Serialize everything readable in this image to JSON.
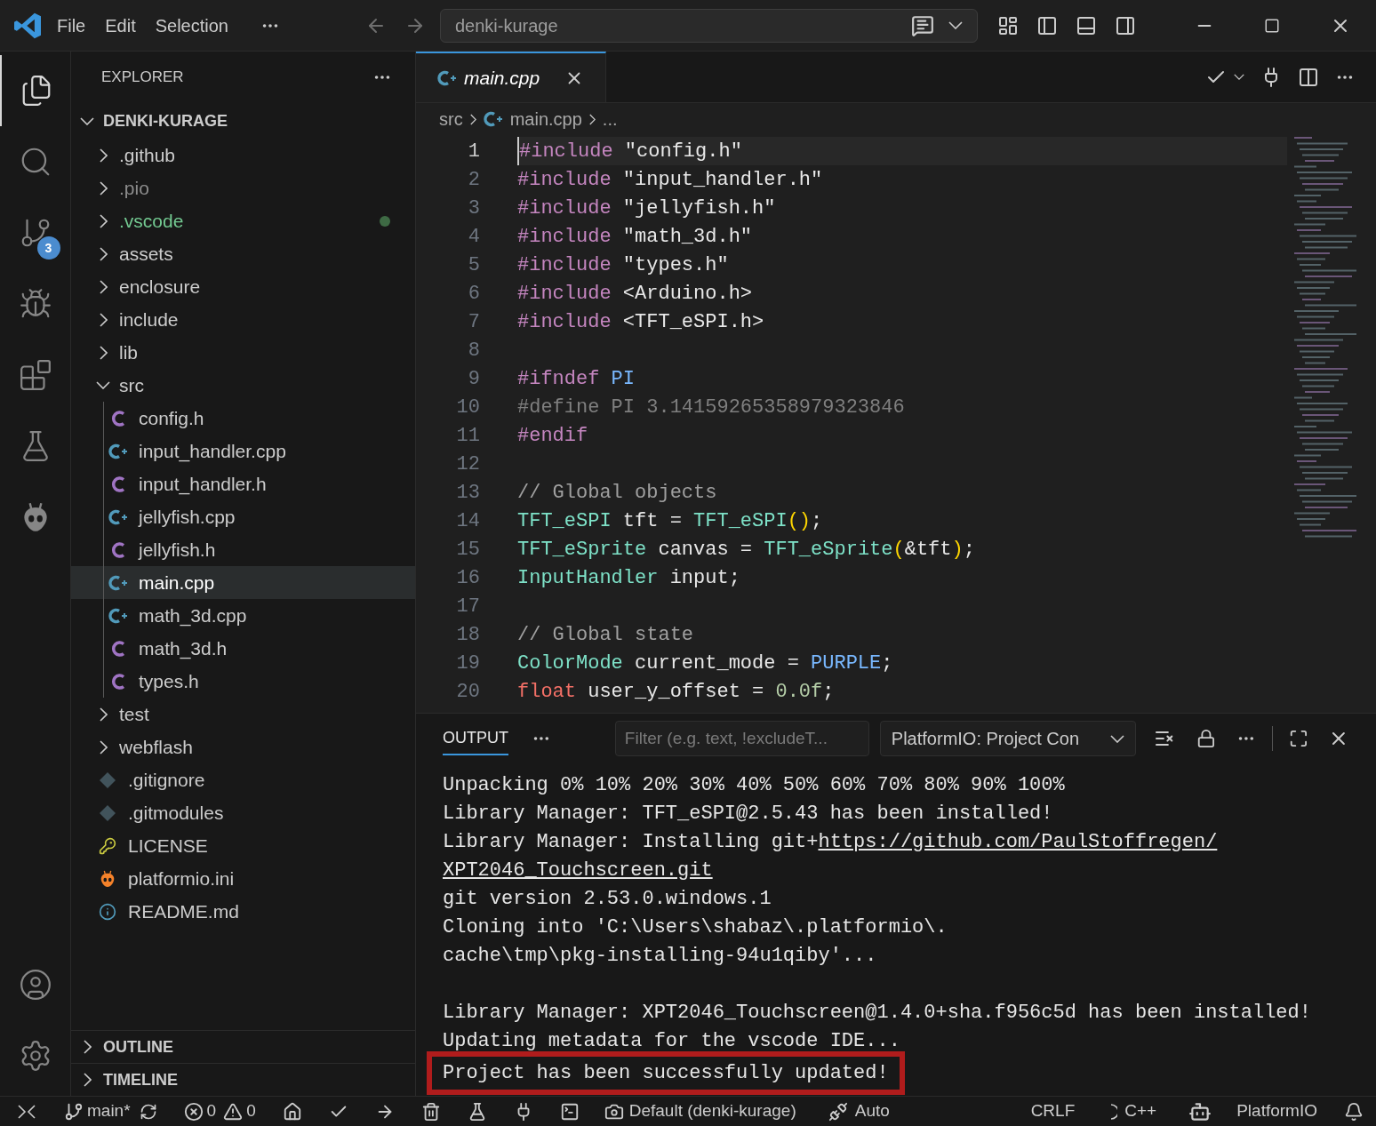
{
  "title_bar": {
    "menu": [
      "File",
      "Edit",
      "Selection"
    ],
    "command_center": "denki-kurage"
  },
  "activity_bar": {
    "items": [
      {
        "kind": "explorer",
        "selected": true
      },
      {
        "kind": "search",
        "selected": false
      },
      {
        "kind": "source-control",
        "selected": false,
        "badge": "3"
      },
      {
        "kind": "run-debug",
        "selected": false
      },
      {
        "kind": "extensions",
        "selected": false
      },
      {
        "kind": "testing",
        "selected": false
      },
      {
        "kind": "platformio",
        "selected": false
      }
    ]
  },
  "explorer": {
    "title": "EXPLORER",
    "root": {
      "label": "DENKI-KURAGE",
      "expanded": true
    },
    "items": [
      {
        "label": ".github",
        "kind": "folder",
        "ignored": false,
        "untracked": false,
        "expanded": false,
        "selected": false
      },
      {
        "label": ".pio",
        "kind": "folder",
        "ignored": true,
        "untracked": false,
        "expanded": false,
        "selected": false
      },
      {
        "label": ".vscode",
        "kind": "folder",
        "ignored": false,
        "untracked": true,
        "expanded": false,
        "selected": false
      },
      {
        "label": "assets",
        "kind": "folder",
        "ignored": false,
        "untracked": false,
        "expanded": false,
        "selected": false
      },
      {
        "label": "enclosure",
        "kind": "folder",
        "ignored": false,
        "untracked": false,
        "expanded": false,
        "selected": false
      },
      {
        "label": "include",
        "kind": "folder",
        "ignored": false,
        "untracked": false,
        "expanded": false,
        "selected": false
      },
      {
        "label": "lib",
        "kind": "folder",
        "ignored": false,
        "untracked": false,
        "expanded": false,
        "selected": false
      },
      {
        "label": "src",
        "kind": "folder",
        "ignored": false,
        "untracked": false,
        "expanded": true,
        "selected": false,
        "children": [
          {
            "label": "config.h",
            "kind": "c",
            "selected": false
          },
          {
            "label": "input_handler.cpp",
            "kind": "cpp",
            "selected": false
          },
          {
            "label": "input_handler.h",
            "kind": "c",
            "selected": false
          },
          {
            "label": "jellyfish.cpp",
            "kind": "cpp",
            "selected": false
          },
          {
            "label": "jellyfish.h",
            "kind": "c",
            "selected": false
          },
          {
            "label": "main.cpp",
            "kind": "cpp",
            "selected": true
          },
          {
            "label": "math_3d.cpp",
            "kind": "cpp",
            "selected": false
          },
          {
            "label": "math_3d.h",
            "kind": "c",
            "selected": false
          },
          {
            "label": "types.h",
            "kind": "c",
            "selected": false
          }
        ]
      },
      {
        "label": "test",
        "kind": "folder",
        "ignored": false,
        "untracked": false,
        "expanded": false,
        "selected": false
      },
      {
        "label": "webflash",
        "kind": "folder",
        "ignored": false,
        "untracked": false,
        "expanded": false,
        "selected": false
      },
      {
        "label": ".gitignore",
        "kind": "git",
        "ignored": false,
        "untracked": false,
        "selected": false
      },
      {
        "label": ".gitmodules",
        "kind": "git",
        "ignored": false,
        "untracked": false,
        "selected": false
      },
      {
        "label": "LICENSE",
        "kind": "license",
        "ignored": false,
        "untracked": false,
        "selected": false
      },
      {
        "label": "platformio.ini",
        "kind": "pio",
        "ignored": false,
        "untracked": false,
        "selected": false
      },
      {
        "label": "README.md",
        "kind": "info",
        "ignored": false,
        "untracked": false,
        "selected": false
      }
    ],
    "sections": [
      {
        "label": "OUTLINE",
        "expanded": false
      },
      {
        "label": "TIMELINE",
        "expanded": false
      }
    ]
  },
  "editor": {
    "tabs": [
      {
        "label": "main.cpp",
        "selected": true
      }
    ],
    "breadcrumbs": [
      "src",
      "main.cpp",
      "..."
    ],
    "lines": [
      {
        "number": "1",
        "selected": true,
        "tokens": [
          {
            "text": "#include",
            "kind": "directive"
          },
          {
            "text": " \"config.h\"",
            "kind": "string"
          }
        ]
      },
      {
        "number": "2",
        "selected": false,
        "tokens": [
          {
            "text": "#include",
            "kind": "directive"
          },
          {
            "text": " \"input_handler.h\"",
            "kind": "string"
          }
        ]
      },
      {
        "number": "3",
        "selected": false,
        "tokens": [
          {
            "text": "#include",
            "kind": "directive"
          },
          {
            "text": " \"jellyfish.h\"",
            "kind": "string"
          }
        ]
      },
      {
        "number": "4",
        "selected": false,
        "tokens": [
          {
            "text": "#include",
            "kind": "directive"
          },
          {
            "text": " \"math_3d.h\"",
            "kind": "string"
          }
        ]
      },
      {
        "number": "5",
        "selected": false,
        "tokens": [
          {
            "text": "#include",
            "kind": "directive"
          },
          {
            "text": " \"types.h\"",
            "kind": "string"
          }
        ]
      },
      {
        "number": "6",
        "selected": false,
        "tokens": [
          {
            "text": "#include",
            "kind": "directive"
          },
          {
            "text": " <Arduino.h>",
            "kind": "string"
          }
        ]
      },
      {
        "number": "7",
        "selected": false,
        "tokens": [
          {
            "text": "#include",
            "kind": "directive"
          },
          {
            "text": " <TFT_eSPI.h>",
            "kind": "string"
          }
        ]
      },
      {
        "number": "8",
        "selected": false
      },
      {
        "number": "9",
        "selected": false,
        "tokens": [
          {
            "text": "#ifndef",
            "kind": "directive"
          },
          {
            "text": " PI",
            "kind": "macro"
          }
        ]
      },
      {
        "number": "10",
        "selected": false,
        "tokens": [
          {
            "text": "#define PI 3.14159265358979323846",
            "kind": "inactive"
          }
        ]
      },
      {
        "number": "11",
        "selected": false,
        "tokens": [
          {
            "text": "#endif",
            "kind": "directive"
          }
        ]
      },
      {
        "number": "12",
        "selected": false
      },
      {
        "number": "13",
        "selected": false,
        "tokens": [
          {
            "text": "// Global objects",
            "kind": "comment"
          }
        ]
      },
      {
        "number": "14",
        "selected": false,
        "tokens": [
          {
            "text": "TFT_eSPI",
            "kind": "type"
          },
          {
            "text": " tft = ",
            "kind": "plain"
          },
          {
            "text": "TFT_eSPI",
            "kind": "type"
          },
          {
            "text": "()",
            "kind": "bracket"
          },
          {
            "text": ";",
            "kind": "plain"
          }
        ]
      },
      {
        "number": "15",
        "selected": false,
        "tokens": [
          {
            "text": "TFT_eSprite",
            "kind": "type"
          },
          {
            "text": " canvas = ",
            "kind": "plain"
          },
          {
            "text": "TFT_eSprite",
            "kind": "type"
          },
          {
            "text": "(",
            "kind": "bracket"
          },
          {
            "text": "&tft",
            "kind": "plain"
          },
          {
            "text": ")",
            "kind": "bracket"
          },
          {
            "text": ";",
            "kind": "plain"
          }
        ]
      },
      {
        "number": "16",
        "selected": false,
        "tokens": [
          {
            "text": "InputHandler",
            "kind": "type"
          },
          {
            "text": " input;",
            "kind": "plain"
          }
        ]
      },
      {
        "number": "17",
        "selected": false
      },
      {
        "number": "18",
        "selected": false,
        "tokens": [
          {
            "text": "// Global state",
            "kind": "comment"
          }
        ]
      },
      {
        "number": "19",
        "selected": false,
        "tokens": [
          {
            "text": "ColorMode",
            "kind": "type"
          },
          {
            "text": " current_mode = ",
            "kind": "plain"
          },
          {
            "text": "PURPLE",
            "kind": "macro"
          },
          {
            "text": ";",
            "kind": "plain"
          }
        ]
      },
      {
        "number": "20",
        "selected": false,
        "tokens": [
          {
            "text": "float",
            "kind": "keyword"
          },
          {
            "text": " user_y_offset = ",
            "kind": "plain"
          },
          {
            "text": "0.0f",
            "kind": "number"
          },
          {
            "text": ";",
            "kind": "plain"
          }
        ]
      }
    ]
  },
  "panel": {
    "tabs": [
      {
        "label": "OUTPUT",
        "selected": true
      }
    ],
    "filter_placeholder": "Filter (e.g. text, !excludeT...",
    "channel": "PlatformIO: Project Con",
    "lines": [
      {
        "kind": "text",
        "text": "Unpacking 0% 10% 20% 30% 40% 50% 60% 70% 80% 90% 100%"
      },
      {
        "kind": "text",
        "text": "Library Manager: TFT_eSPI@2.5.43 has been installed!"
      },
      {
        "kind": "text",
        "text": "Library Manager: Installing git+",
        "link": "https://github.com/PaulStoffregen/"
      },
      {
        "kind": "link",
        "text": "XPT2046_Touchscreen.git"
      },
      {
        "kind": "text",
        "text": "git version 2.53.0.windows.1"
      },
      {
        "kind": "text",
        "text": "Cloning into 'C:\\Users\\shabaz\\.platformio\\."
      },
      {
        "kind": "text",
        "text": "cache\\tmp\\pkg-installing-94u1qiby'..."
      },
      {
        "kind": "blank"
      },
      {
        "kind": "text",
        "text": "Library Manager: XPT2046_Touchscreen@1.4.0+sha.f956c5d has been installed!"
      },
      {
        "kind": "text",
        "text": "Updating metadata for the vscode IDE..."
      }
    ],
    "result_line": {
      "text": "Project has been successfully updated!",
      "highlighted": true
    }
  },
  "status_bar": {
    "branch": "main*",
    "errors": "0",
    "warnings": "0",
    "profile": "Default (denki-kurage)",
    "port": "Auto",
    "eol": "CRLF",
    "language": "C++",
    "platformio": "PlatformIO"
  }
}
